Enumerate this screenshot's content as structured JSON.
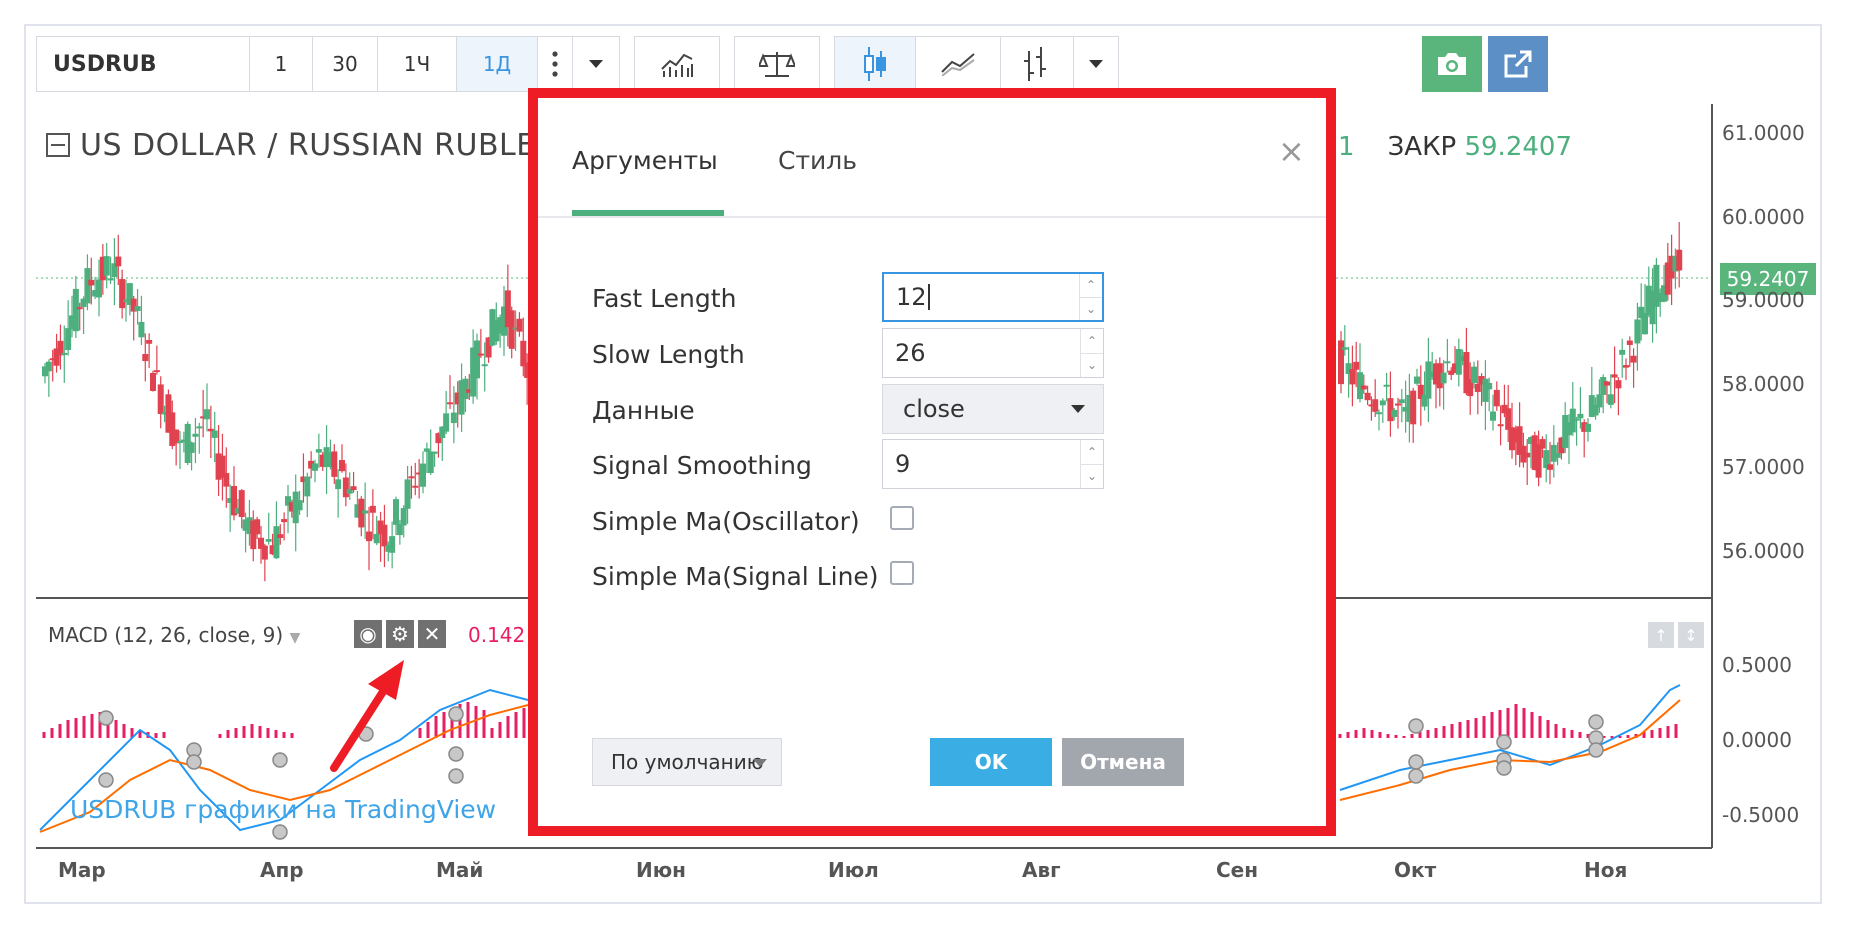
{
  "toolbar": {
    "symbol": "USDRUB",
    "intervals": [
      "1",
      "30",
      "1Ч",
      "1Д"
    ],
    "active_interval": "1Д"
  },
  "chart": {
    "title": "US DOLLAR / RUSSIAN RUBLE",
    "legend_partial_value": "1",
    "close_label": "ЗАКР",
    "close_value": "59.2407",
    "last_price_tag": "59.2407",
    "price_axis": [
      "61.0000",
      "60.0000",
      "59.0000",
      "58.0000",
      "57.0000",
      "56.0000"
    ],
    "macd_axis": [
      "0.5000",
      "0.0000",
      "-0.5000"
    ],
    "time_axis": [
      "Мар",
      "Апр",
      "Май",
      "Июн",
      "Июл",
      "Авг",
      "Сен",
      "Окт",
      "Ноя"
    ],
    "macd_title": "MACD (12, 26, close, 9)",
    "macd_value_partial": "0.142",
    "watermark": "USDRUB графики на TradingView",
    "colors": {
      "up": "#4caf7d",
      "down": "#e0424f",
      "macd_line": "#2196f3",
      "signal_line": "#ff6d00",
      "histogram": "#e91e63"
    }
  },
  "dialog": {
    "tabs": [
      "Аргументы",
      "Стиль"
    ],
    "active_tab": "Аргументы",
    "close_glyph": "×",
    "fields": {
      "fast_length": {
        "label": "Fast Length",
        "value": "12"
      },
      "slow_length": {
        "label": "Slow Length",
        "value": "26"
      },
      "data": {
        "label": "Данные",
        "value": "close"
      },
      "signal_smoothing": {
        "label": "Signal Smoothing",
        "value": "9"
      },
      "simple_ma_osc": {
        "label": "Simple Ma(Oscillator)",
        "checked": false
      },
      "simple_ma_signal": {
        "label": "Simple Ma(Signal Line)",
        "checked": false
      }
    },
    "defaults_label": "По умолчанию",
    "ok_label": "OK",
    "cancel_label": "Отмена"
  }
}
